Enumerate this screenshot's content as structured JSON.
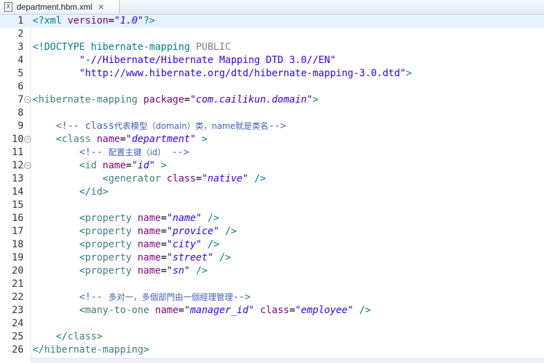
{
  "tab": {
    "title": "department.hbm.xml",
    "icon": "xml-file-icon",
    "close_glyph": "✕"
  },
  "lines": [
    {
      "n": "1",
      "fold": false,
      "current": true,
      "parts": [
        [
          "bracket",
          "<?"
        ],
        [
          "decl",
          "xml "
        ],
        [
          "attr",
          "version"
        ],
        [
          "text",
          "="
        ],
        [
          "val",
          "\"1.0\""
        ],
        [
          "bracket",
          "?>"
        ]
      ]
    },
    {
      "n": "2",
      "fold": false,
      "current": false,
      "parts": []
    },
    {
      "n": "3",
      "fold": false,
      "current": false,
      "parts": [
        [
          "bracket",
          "<!"
        ],
        [
          "decl",
          "DOCTYPE hibernate-mapping "
        ],
        [
          "kw",
          "PUBLIC"
        ]
      ]
    },
    {
      "n": "4",
      "fold": false,
      "current": false,
      "parts": [
        [
          "text",
          "        "
        ],
        [
          "str",
          "\"-//Hibernate/Hibernate Mapping DTD 3.0//EN\""
        ]
      ]
    },
    {
      "n": "5",
      "fold": false,
      "current": false,
      "parts": [
        [
          "text",
          "        "
        ],
        [
          "str",
          "\"http://www.hibernate.org/dtd/hibernate-mapping-3.0.dtd\""
        ],
        [
          "bracket",
          ">"
        ]
      ]
    },
    {
      "n": "6",
      "fold": false,
      "current": false,
      "parts": []
    },
    {
      "n": "7",
      "fold": true,
      "current": false,
      "parts": [
        [
          "bracket",
          "<"
        ],
        [
          "tagname",
          "hibernate-mapping "
        ],
        [
          "attr",
          "package"
        ],
        [
          "text",
          "="
        ],
        [
          "val",
          "\"com.cailikun.domain\""
        ],
        [
          "bracket",
          ">"
        ]
      ]
    },
    {
      "n": "8",
      "fold": false,
      "current": false,
      "parts": []
    },
    {
      "n": "9",
      "fold": false,
      "current": false,
      "parts": [
        [
          "text",
          "    "
        ],
        [
          "comment",
          "<!-- class"
        ],
        [
          "comment cjk",
          "代表模型（domain）类，name就是类名"
        ],
        [
          "comment",
          "-->"
        ]
      ]
    },
    {
      "n": "10",
      "fold": true,
      "current": false,
      "parts": [
        [
          "text",
          "    "
        ],
        [
          "bracket",
          "<"
        ],
        [
          "tagname",
          "class "
        ],
        [
          "attr",
          "name"
        ],
        [
          "text",
          "="
        ],
        [
          "val",
          "\"department\""
        ],
        [
          "bracket",
          " >"
        ]
      ]
    },
    {
      "n": "11",
      "fold": false,
      "current": false,
      "parts": [
        [
          "text",
          "        "
        ],
        [
          "comment",
          "<!-- "
        ],
        [
          "comment cjk",
          "配置主键（id）"
        ],
        [
          "comment",
          " -->"
        ]
      ]
    },
    {
      "n": "12",
      "fold": true,
      "current": false,
      "parts": [
        [
          "text",
          "        "
        ],
        [
          "bracket",
          "<"
        ],
        [
          "tagname",
          "id "
        ],
        [
          "attr",
          "name"
        ],
        [
          "text",
          "="
        ],
        [
          "val",
          "\"id\""
        ],
        [
          "bracket",
          " >"
        ]
      ]
    },
    {
      "n": "13",
      "fold": false,
      "current": false,
      "parts": [
        [
          "text",
          "            "
        ],
        [
          "bracket",
          "<"
        ],
        [
          "tagname",
          "generator "
        ],
        [
          "attr",
          "class"
        ],
        [
          "text",
          "="
        ],
        [
          "val",
          "\"native\""
        ],
        [
          "bracket",
          " />"
        ]
      ]
    },
    {
      "n": "14",
      "fold": false,
      "current": false,
      "parts": [
        [
          "text",
          "        "
        ],
        [
          "bracket",
          "</"
        ],
        [
          "tagname",
          "id"
        ],
        [
          "bracket",
          ">"
        ]
      ]
    },
    {
      "n": "15",
      "fold": false,
      "current": false,
      "parts": []
    },
    {
      "n": "16",
      "fold": false,
      "current": false,
      "parts": [
        [
          "text",
          "        "
        ],
        [
          "bracket",
          "<"
        ],
        [
          "tagname",
          "property "
        ],
        [
          "attr",
          "name"
        ],
        [
          "text",
          "="
        ],
        [
          "val",
          "\"name\""
        ],
        [
          "bracket",
          " />"
        ]
      ]
    },
    {
      "n": "17",
      "fold": false,
      "current": false,
      "parts": [
        [
          "text",
          "        "
        ],
        [
          "bracket",
          "<"
        ],
        [
          "tagname",
          "property "
        ],
        [
          "attr",
          "name"
        ],
        [
          "text",
          "="
        ],
        [
          "val",
          "\"provice\""
        ],
        [
          "bracket",
          " />"
        ]
      ]
    },
    {
      "n": "18",
      "fold": false,
      "current": false,
      "parts": [
        [
          "text",
          "        "
        ],
        [
          "bracket",
          "<"
        ],
        [
          "tagname",
          "property "
        ],
        [
          "attr",
          "name"
        ],
        [
          "text",
          "="
        ],
        [
          "val",
          "\"city\""
        ],
        [
          "bracket",
          " />"
        ]
      ]
    },
    {
      "n": "19",
      "fold": false,
      "current": false,
      "parts": [
        [
          "text",
          "        "
        ],
        [
          "bracket",
          "<"
        ],
        [
          "tagname",
          "property "
        ],
        [
          "attr",
          "name"
        ],
        [
          "text",
          "="
        ],
        [
          "val",
          "\"street\""
        ],
        [
          "bracket",
          " />"
        ]
      ]
    },
    {
      "n": "20",
      "fold": false,
      "current": false,
      "parts": [
        [
          "text",
          "        "
        ],
        [
          "bracket",
          "<"
        ],
        [
          "tagname",
          "property "
        ],
        [
          "attr",
          "name"
        ],
        [
          "text",
          "="
        ],
        [
          "val",
          "\"sn\""
        ],
        [
          "bracket",
          " />"
        ]
      ]
    },
    {
      "n": "21",
      "fold": false,
      "current": false,
      "parts": []
    },
    {
      "n": "22",
      "fold": false,
      "current": false,
      "parts": [
        [
          "text",
          "        "
        ],
        [
          "comment",
          "<!-- "
        ],
        [
          "comment cjk",
          "多对一，多個部門由一個經理管理"
        ],
        [
          "comment",
          "-->"
        ]
      ]
    },
    {
      "n": "23",
      "fold": false,
      "current": false,
      "parts": [
        [
          "text",
          "        "
        ],
        [
          "bracket",
          "<"
        ],
        [
          "tagname",
          "many-to-one "
        ],
        [
          "attr",
          "name"
        ],
        [
          "text",
          "="
        ],
        [
          "val",
          "\"manager_id\""
        ],
        [
          "text",
          " "
        ],
        [
          "attr",
          "class"
        ],
        [
          "text",
          "="
        ],
        [
          "val",
          "\"employee\""
        ],
        [
          "bracket",
          " />"
        ]
      ]
    },
    {
      "n": "24",
      "fold": false,
      "current": false,
      "parts": []
    },
    {
      "n": "25",
      "fold": false,
      "current": false,
      "parts": [
        [
          "text",
          "    "
        ],
        [
          "bracket",
          "</"
        ],
        [
          "tagname",
          "class"
        ],
        [
          "bracket",
          ">"
        ]
      ]
    },
    {
      "n": "26",
      "fold": false,
      "current": false,
      "parts": [
        [
          "bracket",
          "</"
        ],
        [
          "tagname",
          "hibernate-mapping"
        ],
        [
          "bracket",
          ">"
        ]
      ]
    }
  ]
}
